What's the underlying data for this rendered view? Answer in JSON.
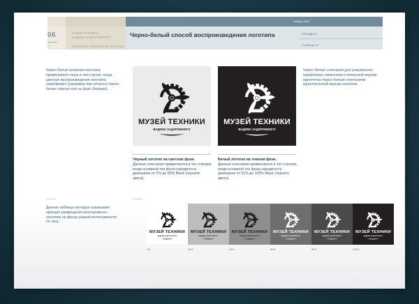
{
  "header": {
    "date": "Ноябрь 2011",
    "section_number": "06",
    "page_marker": "1",
    "chapter_line1": "Музей техники",
    "chapter_line2": "Вадима Задорожного",
    "chapter_sub": "Базовые элементы бренда",
    "title": "Черно-белый способ воспроизведения логотипа",
    "doc_label": "Брендбук",
    "page_label": "Страница 19"
  },
  "left_text": "Черно-белые решения логотипа применяются лишь в том случае, когда цветное воспроизведение логотипа невозможно (например при печати в черно-белых газетах или на факс-бланках).",
  "right_text": "Черно-белые сочетания для уникального шрифтового написания и латинской версии идентичны черно-белым сочетаниям кириллической версии логотипа.",
  "bottom_text": "Данная таблица наглядно показывает принцип размещения монохромного логотипа на фонах разной интенсивности по тону.",
  "logo": {
    "name": "МУЗЕЙ ТЕХНИКИ",
    "subtitle": "ВАДИМА ЗАДОРОЖНОГО",
    "icon": "propeller-gear-icon"
  },
  "captions": {
    "light_title": "Черный логотип на светлом фоне.",
    "light_body": "Данные сочетания применяются в тех случаях, когда основной тон фона находится в диапазоне от 0% до 50% Black (черного цвета).",
    "dark_title": "Белый логотип на темном фоне.",
    "dark_body": "Данные сочетания применяются в тех случаях, когда основной тон фона находится в диапазоне от 51% до 100% Black (черного цвета)."
  },
  "colors": {
    "light_panel": "#ebebeb",
    "dark_panel": "#231f20",
    "header_band": "#6f8b99"
  },
  "strip": {
    "tiles": [
      {
        "bg": "#ffffff",
        "logo": "#1a1a1a"
      },
      {
        "bg": "#bdbdbd",
        "logo": "#1a1a1a"
      },
      {
        "bg": "#8f8f8f",
        "logo": "#1a1a1a"
      },
      {
        "bg": "#6e6e6e",
        "logo": "#ffffff"
      },
      {
        "bg": "#4a4a4a",
        "logo": "#ffffff"
      },
      {
        "bg": "#231f20",
        "logo": "#ffffff"
      }
    ],
    "percent_labels": [
      "0%",
      "30%",
      "40%",
      "60%",
      "80%",
      "100%"
    ]
  }
}
